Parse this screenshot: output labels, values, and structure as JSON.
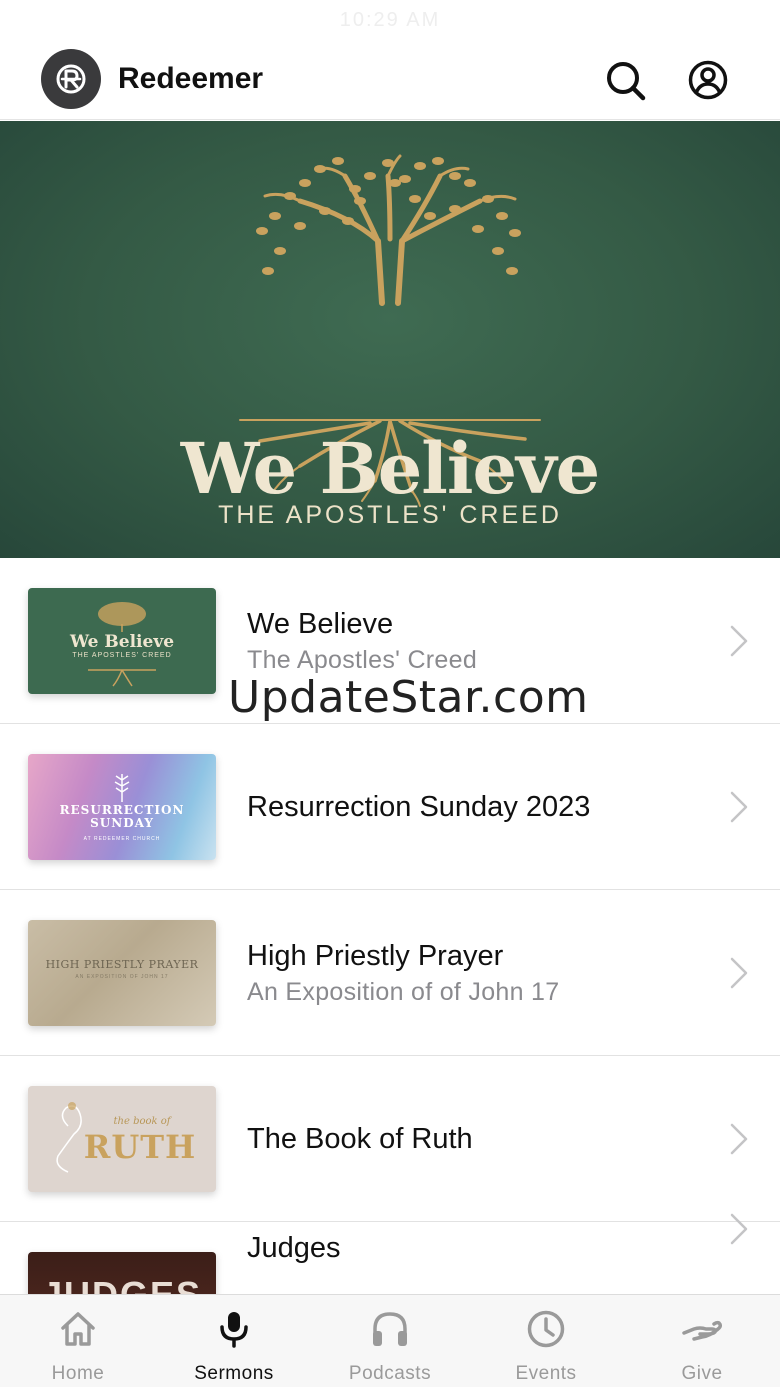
{
  "status_bar": {
    "time": "10:29 AM"
  },
  "header": {
    "title": "Redeemer",
    "logo_letter": "R",
    "search_icon": "search-icon",
    "profile_icon": "profile-icon"
  },
  "hero": {
    "title": "We Believe",
    "subtitle": "THE APOSTLES' CREED"
  },
  "sermon_series": [
    {
      "title": "We Believe",
      "subtitle": "The Apostles' Creed",
      "thumb_title": "We Believe",
      "thumb_sub": "THE APOSTLES' CREED"
    },
    {
      "title": "Resurrection Sunday 2023",
      "subtitle": "",
      "thumb_title": "RESURRECTION SUNDAY",
      "thumb_sub": "AT REDEEMER CHURCH"
    },
    {
      "title": "High Priestly Prayer",
      "subtitle": "An Exposition of of John 17",
      "thumb_title": "HIGH PRIESTLY PRAYER",
      "thumb_sub": "AN EXPOSITION OF JOHN 17"
    },
    {
      "title": "The Book of Ruth",
      "subtitle": "",
      "thumb_title": "RUTH",
      "thumb_sub": "the book of"
    },
    {
      "title": "Judges",
      "subtitle": "",
      "thumb_title": "JUDGES",
      "thumb_sub": ""
    }
  ],
  "watermark": "UpdateStar.com",
  "tabs": [
    {
      "label": "Home",
      "icon": "home-icon",
      "active": false
    },
    {
      "label": "Sermons",
      "icon": "microphone-icon",
      "active": true
    },
    {
      "label": "Podcasts",
      "icon": "headphones-icon",
      "active": false
    },
    {
      "label": "Events",
      "icon": "clock-icon",
      "active": false
    },
    {
      "label": "Give",
      "icon": "giving-hand-icon",
      "active": false
    }
  ],
  "colors": {
    "hero_green": "#345a45",
    "gold": "#c9a25e",
    "tab_active": "#111111",
    "tab_inactive": "#9a9a9a"
  }
}
